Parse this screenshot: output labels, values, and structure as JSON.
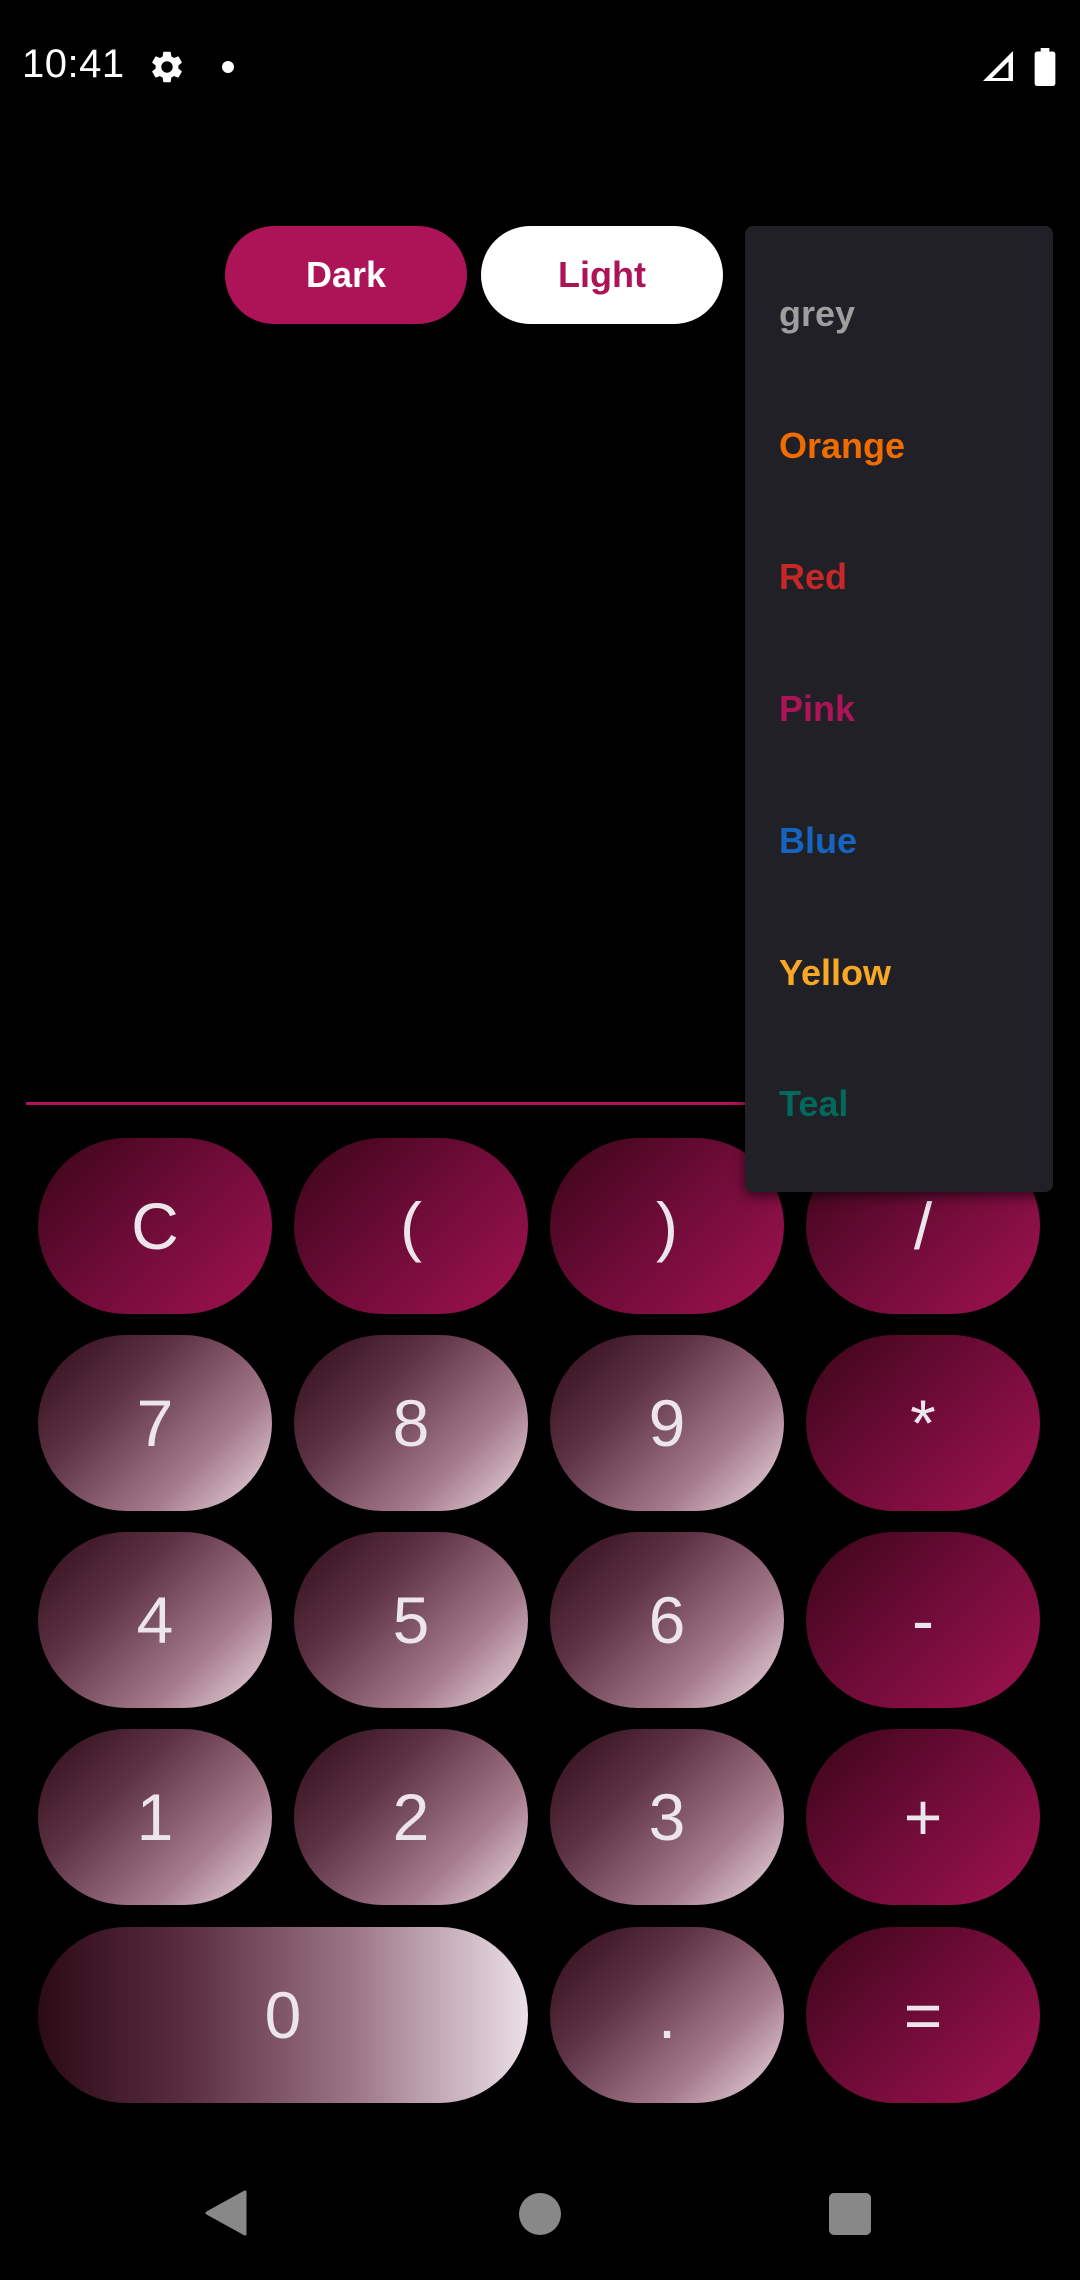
{
  "status_bar": {
    "time": "10:41"
  },
  "theme_toggle": {
    "dark_label": "Dark",
    "light_label": "Light"
  },
  "color_menu": {
    "items": [
      {
        "label": "grey",
        "color": "#9e9e9e"
      },
      {
        "label": "Orange",
        "color": "#ef6c00"
      },
      {
        "label": "Red",
        "color": "#c62828"
      },
      {
        "label": "Pink",
        "color": "#ad1457"
      },
      {
        "label": "Blue",
        "color": "#1565c0"
      },
      {
        "label": "Yellow",
        "color": "#f9a825"
      },
      {
        "label": "Teal",
        "color": "#00695c"
      }
    ]
  },
  "display": {
    "expression": "",
    "accent": "#ad1457"
  },
  "keypad": {
    "rows": [
      [
        "C",
        "(",
        ")",
        "/"
      ],
      [
        "7",
        "8",
        "9",
        "*"
      ],
      [
        "4",
        "5",
        "6",
        "-"
      ],
      [
        "1",
        "2",
        "3",
        "+"
      ],
      [
        "0",
        ".",
        "="
      ]
    ]
  }
}
